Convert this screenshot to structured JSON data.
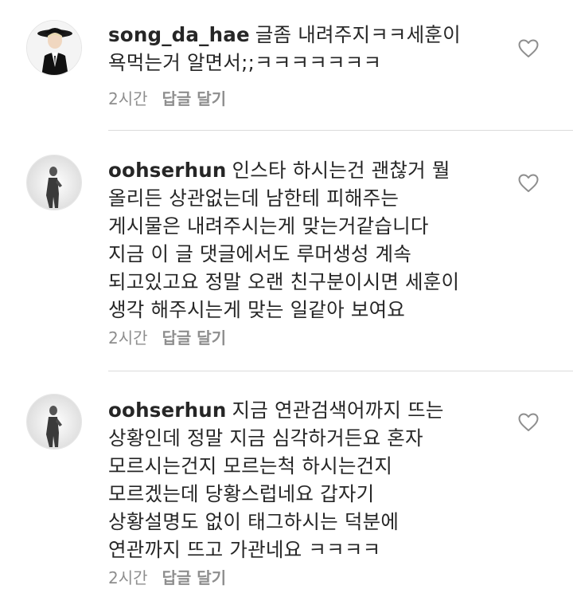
{
  "comments": [
    {
      "username": "song_da_hae",
      "lines": [
        "글좀 내려주지ㅋㅋ세훈이",
        "욕먹는거 알면서;;ㅋㅋㅋㅋㅋㅋㅋ"
      ],
      "time": "2시간",
      "reply_label": "답글 달기",
      "avatar_icon": "profile-photo"
    },
    {
      "username": "oohserhun",
      "lines": [
        "인스타 하시는건 괜찮거 뭘",
        "올리든 상관없는데 남한테 피해주는",
        "게시물은 내려주시는게 맞는거같습니다",
        "지금 이 글 댓글에서도 루머생성 계속",
        "되고있고요 정말 오랜 친구분이시면 세훈이",
        "생각 해주시는게 맞는 일같아 보여요"
      ],
      "time": "2시간",
      "reply_label": "답글 달기",
      "avatar_icon": "profile-photo"
    },
    {
      "username": "oohserhun",
      "lines": [
        "지금 연관검색어까지 뜨는",
        "상황인데 정말 지금 심각하거든요 혼자",
        "모르시는건지 모르는척 하시는건지",
        "모르겠는데 당황스럽네요 갑자기",
        "상황설명도 없이 태그하시는 덕분에",
        "연관까지 뜨고 가관네요 ㅋㅋㅋㅋ"
      ],
      "time": "2시간",
      "reply_label": "답글 달기",
      "avatar_icon": "profile-photo"
    }
  ],
  "icons": {
    "like": "heart-outline-icon"
  },
  "colors": {
    "text": "#262626",
    "meta": "#8e8e8e",
    "divider": "#dbdbdb"
  }
}
